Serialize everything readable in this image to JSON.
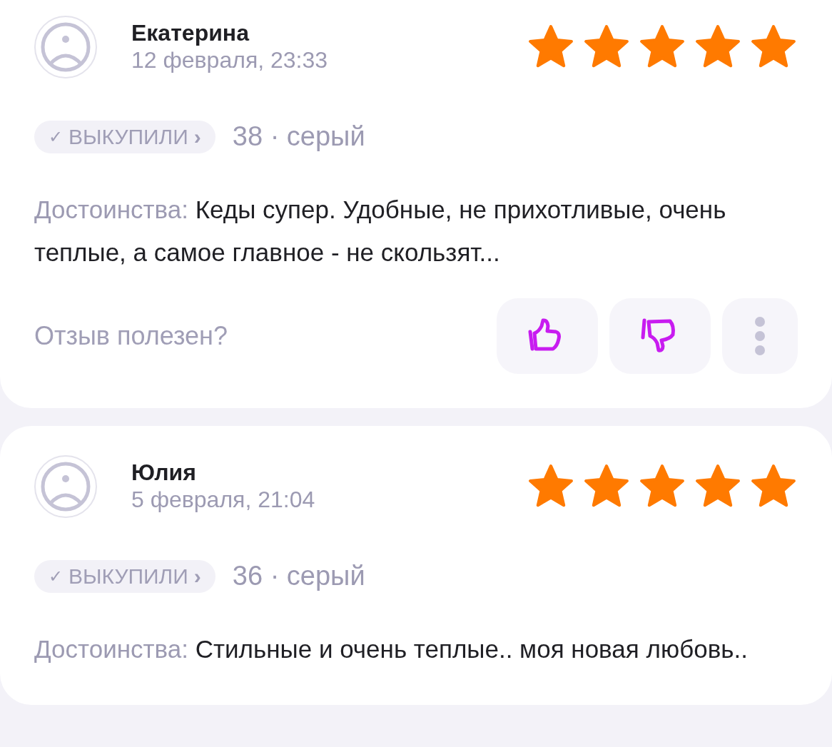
{
  "reviews": [
    {
      "author": "Екатерина",
      "date": "12 февраля, 23:33",
      "stars": 5,
      "badge": {
        "check": "✓",
        "label": "ВЫКУПИЛИ",
        "chevron": "›"
      },
      "variant": "38 · серый",
      "label": "Достоинства:",
      "text": "Кеды супер. Удобные, не прихотливые, очень теплые, а самое главное - не скользят...",
      "footer": {
        "question": "Отзыв полезен?"
      }
    },
    {
      "author": "Юлия",
      "date": "5 февраля, 21:04",
      "stars": 5,
      "badge": {
        "check": "✓",
        "label": "ВЫКУПИЛИ",
        "chevron": "›"
      },
      "variant": "36 · серый",
      "label": "Достоинства:",
      "text": "Стильные и очень теплые.. моя новая любовь.."
    }
  ]
}
